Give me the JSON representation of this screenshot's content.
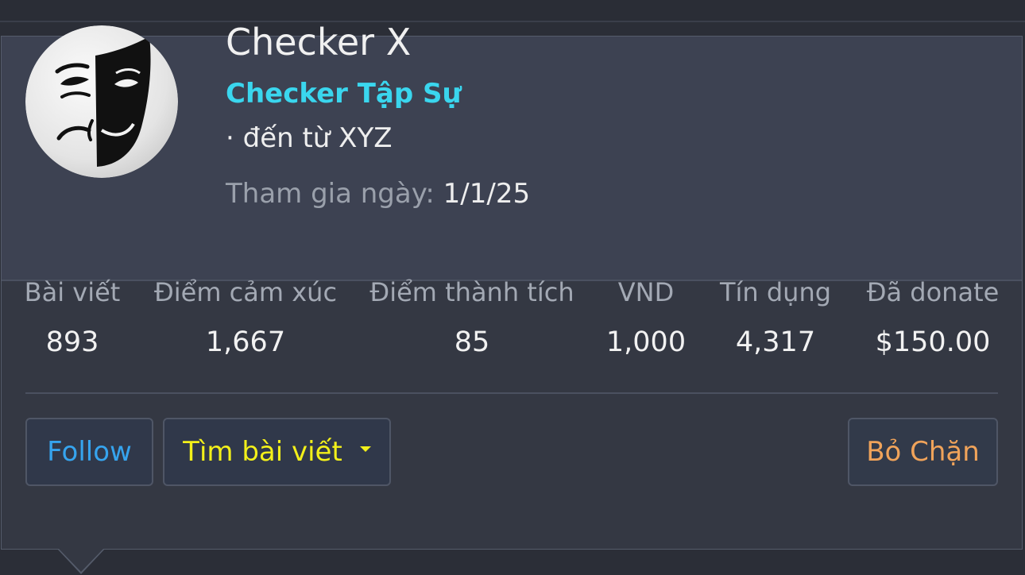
{
  "profile": {
    "name": "Checker X",
    "title": "Checker Tập Sự",
    "location": "· đến từ XYZ",
    "joined_label": "Tham gia ngày:",
    "joined_value": "1/1/25",
    "avatar_icon": "theater-mask-icon"
  },
  "stats": [
    {
      "label": "Bài viết",
      "value": "893"
    },
    {
      "label": "Điểm cảm xúc",
      "value": "1,667"
    },
    {
      "label": "Điểm thành tích",
      "value": "85"
    },
    {
      "label": "VND",
      "value": "1,000"
    },
    {
      "label": "Tín dụng",
      "value": "4,317"
    },
    {
      "label": "Đã donate",
      "value": "$150.00"
    }
  ],
  "actions": {
    "follow_label": "Follow",
    "find_posts_label": "Tìm bài viết",
    "unblock_label": "Bỏ Chặn"
  },
  "colors": {
    "title": "#3ad6ee",
    "follow": "#36a4ee",
    "find_posts": "#f3f01a",
    "unblock": "#f0a35a"
  }
}
